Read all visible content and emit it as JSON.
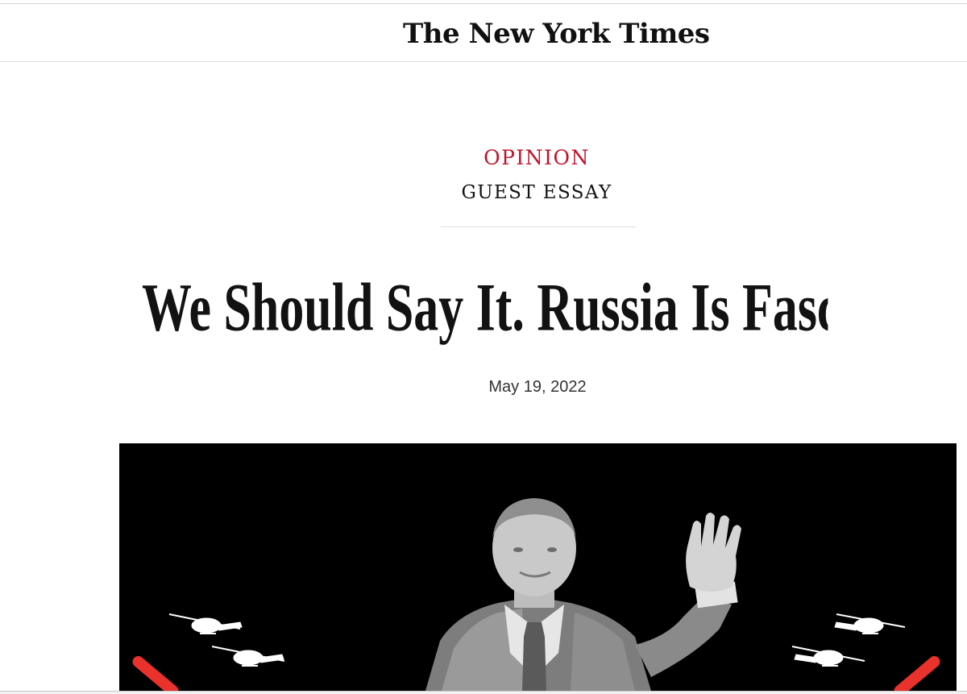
{
  "masthead": {
    "logo_text": "The New York Times"
  },
  "article": {
    "kicker": "OPINION",
    "subkicker": "GUEST ESSAY",
    "headline": "We Should Say It. Russia Is Fascist.",
    "date": "May 19, 2022"
  },
  "hero_image": {
    "description_icons": [
      "helicopter-icon",
      "missile-icon"
    ]
  },
  "colors": {
    "kicker_red": "#c3112b",
    "text": "#121212",
    "hero_background": "#000000",
    "missile_red": "#e8322b"
  }
}
